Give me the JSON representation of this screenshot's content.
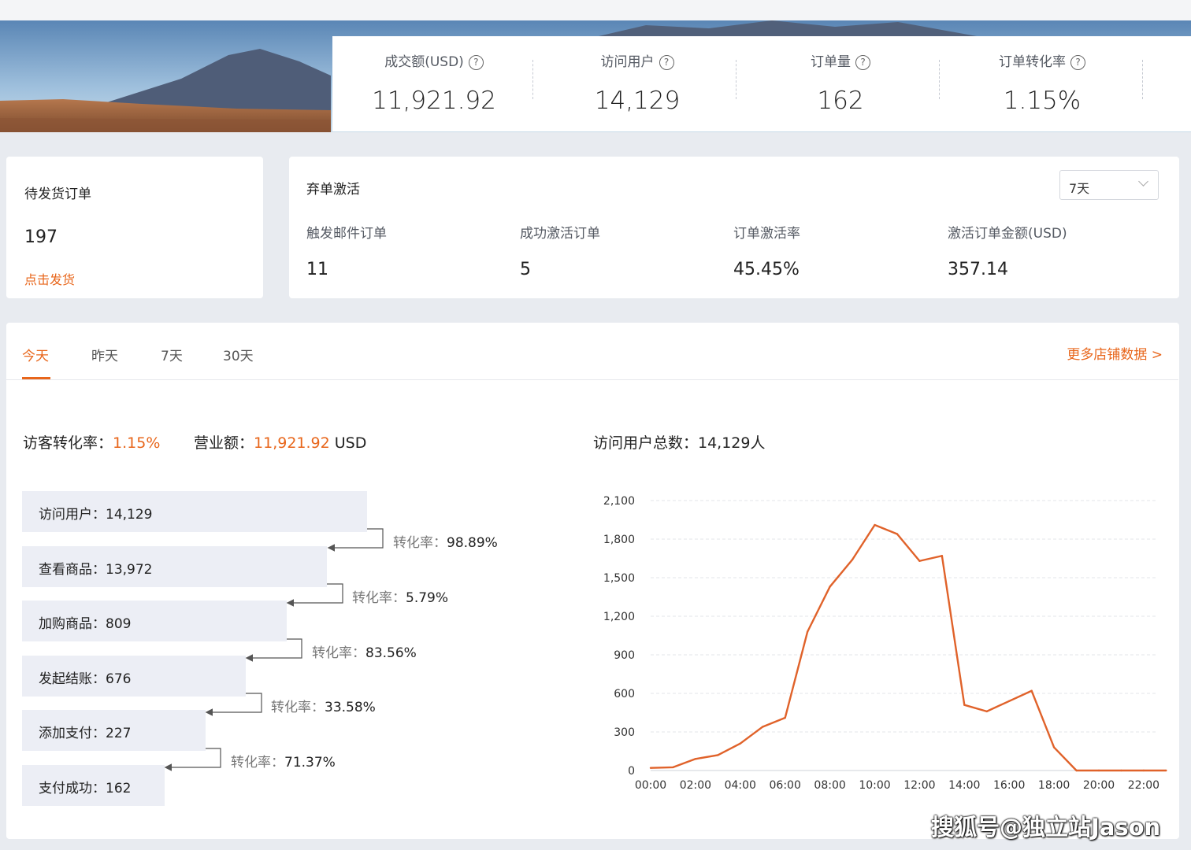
{
  "stats": [
    {
      "label": "成交额(USD)",
      "value": "11,921.92"
    },
    {
      "label": "访问用户",
      "value": "14,129"
    },
    {
      "label": "订单量",
      "value": "162"
    },
    {
      "label": "订单转化率",
      "value": "1.15%"
    }
  ],
  "help_glyph": "?",
  "pending": {
    "title": "待发货订单",
    "count": "197",
    "link": "点击发货"
  },
  "abandon": {
    "title": "弃单激活",
    "range": "7天",
    "metrics": [
      {
        "label": "触发邮件订单",
        "value": "11"
      },
      {
        "label": "成功激活订单",
        "value": "5"
      },
      {
        "label": "订单激活率",
        "value": "45.45%"
      },
      {
        "label": "激活订单金额(USD)",
        "value": "357.14"
      }
    ]
  },
  "tabs": [
    {
      "label": "今天",
      "active": true
    },
    {
      "label": "昨天"
    },
    {
      "label": "7天"
    },
    {
      "label": "30天"
    }
  ],
  "more_link": "更多店铺数据 >",
  "summary": {
    "conv_label": "访客转化率：",
    "conv_value": "1.15%",
    "revenue_label": "营业额：",
    "revenue_value": "11,921.92",
    "revenue_unit": " USD",
    "visitors_total": "访问用户总数：14,129人"
  },
  "funnel": {
    "stages": [
      {
        "label": "访问用户：14,129",
        "value": 14129
      },
      {
        "label": "查看商品：13,972",
        "value": 13972
      },
      {
        "label": "加购商品：809",
        "value": 809
      },
      {
        "label": "发起结账：676",
        "value": 676
      },
      {
        "label": "添加支付：227",
        "value": 227
      },
      {
        "label": "支付成功：162",
        "value": 162
      }
    ],
    "rate_label": "转化率：",
    "rates": [
      "98.89%",
      "5.79%",
      "83.56%",
      "33.58%",
      "71.37%"
    ]
  },
  "chart_data": {
    "type": "line",
    "x": [
      "00:00",
      "01:00",
      "02:00",
      "03:00",
      "04:00",
      "05:00",
      "06:00",
      "07:00",
      "08:00",
      "09:00",
      "10:00",
      "11:00",
      "12:00",
      "13:00",
      "14:00",
      "15:00",
      "16:00",
      "17:00",
      "18:00",
      "19:00",
      "20:00",
      "21:00",
      "22:00",
      "23:00"
    ],
    "x_tick_labels": [
      "00:00",
      "02:00",
      "04:00",
      "06:00",
      "08:00",
      "10:00",
      "12:00",
      "14:00",
      "16:00",
      "18:00",
      "20:00",
      "22:00"
    ],
    "y_tick_labels": [
      "0",
      "300",
      "600",
      "900",
      "1,200",
      "1,500",
      "1,800",
      "2,100"
    ],
    "series": [
      {
        "values": [
          20,
          25,
          90,
          120,
          210,
          340,
          410,
          1080,
          1430,
          1640,
          1910,
          1840,
          1630,
          1670,
          510,
          460,
          540,
          620,
          180,
          0,
          0,
          0,
          0,
          0
        ]
      }
    ],
    "ylim": [
      0,
      2100
    ],
    "grid": true,
    "line_color": "#e0622a"
  },
  "watermark": "搜狐号@独立站Jason"
}
